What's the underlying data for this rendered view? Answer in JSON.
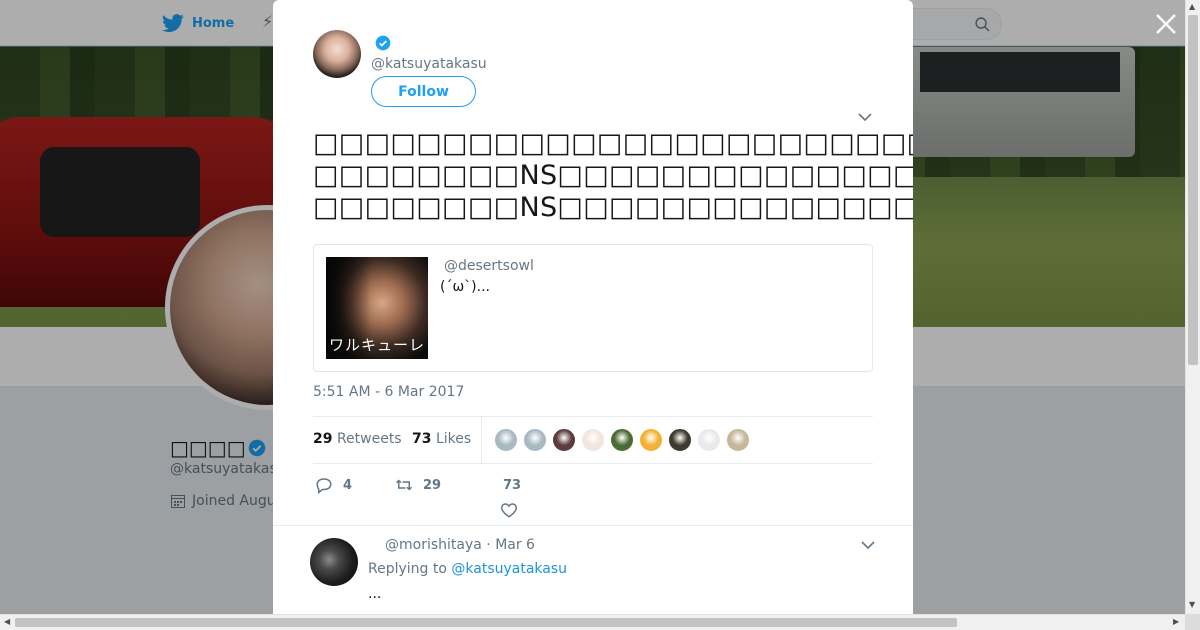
{
  "nav": {
    "home_label": "Home",
    "moments_glyph": "⚡",
    "icons": [
      "twitter-bird-icon",
      "search-icon"
    ]
  },
  "profile": {
    "name": "□□□□",
    "handle": "@katsuyatakas",
    "joined": "Joined Augu"
  },
  "tweet": {
    "handle": "@katsuyatakasu",
    "follow_label": "Follow",
    "text": "□□□□□□□□□□□□□□□□□□□□□□□□□□□□□□□□□□□□□□□□□□□\n□□□□□□□□NS□□□□□□□□□□□□□□□□□□□□□□□□□□□□□□\n□□□□□□□□NS□□□□□□□□□□□□□□□□□□□□□□□□□□□□□□□□□□□□□",
    "quote": {
      "handle": "@desertsowl",
      "text": "(´ω`)...",
      "image_caption": "ワルキューレ"
    },
    "timestamp": "5:51 AM - 6 Mar 2017",
    "stats": {
      "retweets_count": "29",
      "retweets_label": "Retweets",
      "likes_count": "73",
      "likes_label": "Likes"
    },
    "likers_colors": [
      "#aab8c2",
      "#aab8c2",
      "#5b3c3f",
      "#f2e6df",
      "#4b6b34",
      "#f2b134",
      "#3b3a2e",
      "#e9e9e9",
      "#c6b79a"
    ],
    "actions": {
      "reply_count": "4",
      "retweet_count": "29",
      "like_count": "73"
    }
  },
  "reply": {
    "header": "@morishitaya · Mar 6",
    "replying_prefix": "Replying to",
    "replying_to": "@katsuyatakasu",
    "text": "..."
  },
  "colors": {
    "accent": "#1da1f2",
    "muted": "#657786",
    "text": "#14171a"
  }
}
